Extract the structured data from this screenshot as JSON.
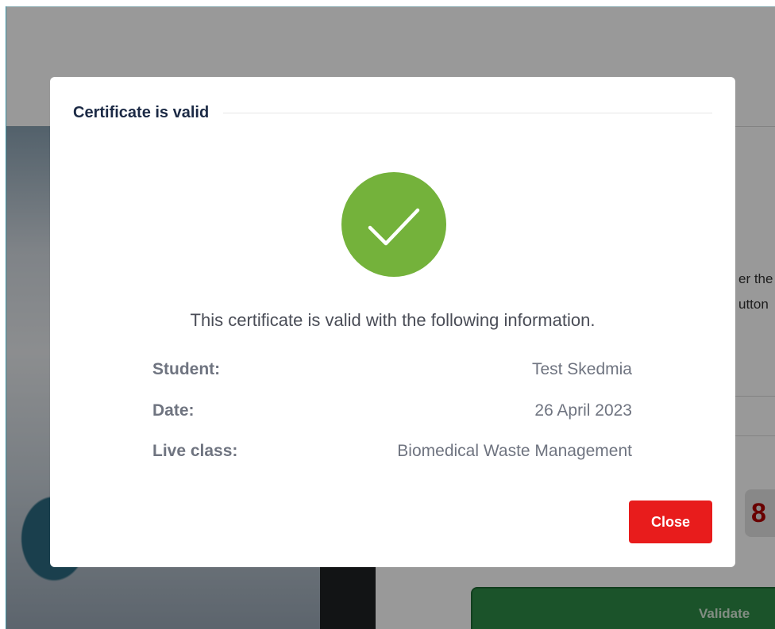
{
  "background_page": {
    "side_text_line1": "er the",
    "side_text_line2": "utton",
    "counter_digit": "8",
    "validate_label": "Validate"
  },
  "modal": {
    "title": "Certificate is valid",
    "icon": "check-circle-icon",
    "intro": "This certificate is valid with the following information.",
    "fields": [
      {
        "label": "Student:",
        "value": "Test Skedmia"
      },
      {
        "label": "Date:",
        "value": "26 April 2023"
      },
      {
        "label": "Live class:",
        "value": "Biomedical Waste Management"
      }
    ],
    "close_label": "Close"
  },
  "colors": {
    "success_green": "#74b23b",
    "close_red": "#e81c1c",
    "validate_green": "#2e8b47",
    "title_navy": "#1c2a45"
  }
}
